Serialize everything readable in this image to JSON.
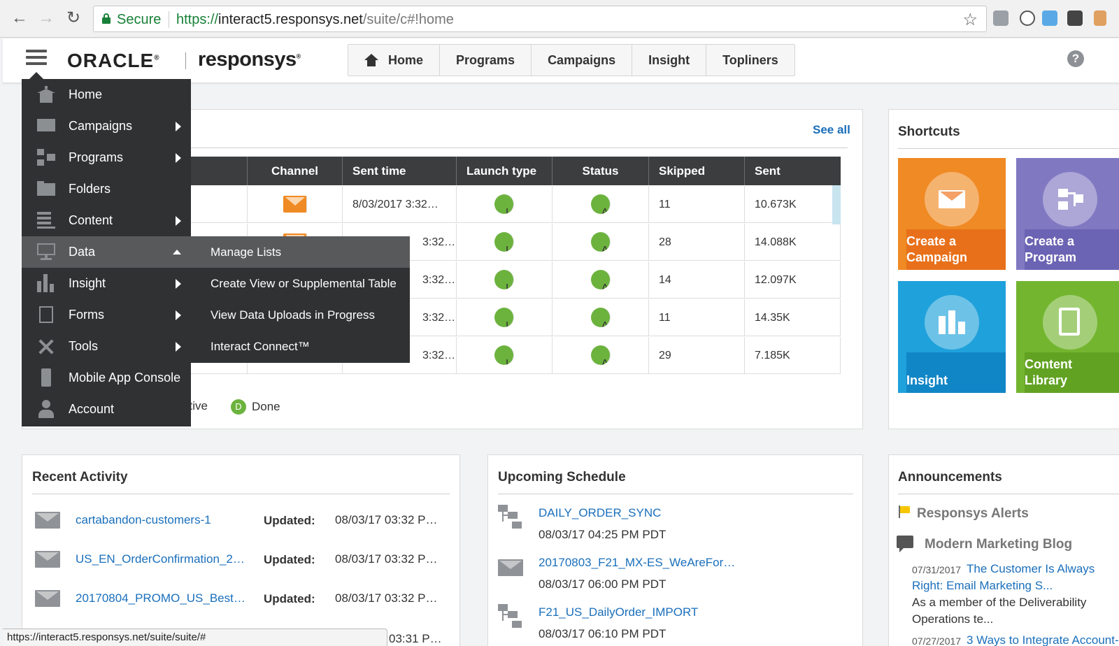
{
  "browser": {
    "secure_label": "Secure",
    "url_scheme": "https://",
    "url_host": "interact5.responsys.net",
    "url_path": "/suite/c#!home",
    "back": "←",
    "forward": "→",
    "reload": "↻",
    "star": "☆"
  },
  "header": {
    "logo_oracle": "ORACLE",
    "logo_reg": "®",
    "logo_responsys": "responsys",
    "logo_tm": "®",
    "help": "?",
    "nav_tabs": [
      {
        "label": "Home"
      },
      {
        "label": "Programs"
      },
      {
        "label": "Campaigns"
      },
      {
        "label": "Insight"
      },
      {
        "label": "Topliners"
      }
    ]
  },
  "side_menu": {
    "items": [
      {
        "label": "Home",
        "icon": "home-icon"
      },
      {
        "label": "Campaigns",
        "icon": "envelope-icon"
      },
      {
        "label": "Programs",
        "icon": "program-icon"
      },
      {
        "label": "Folders",
        "icon": "folder-icon"
      },
      {
        "label": "Content",
        "icon": "content-icon"
      },
      {
        "label": "Data",
        "icon": "data-icon"
      },
      {
        "label": "Insight",
        "icon": "bar-chart-icon"
      },
      {
        "label": "Forms",
        "icon": "forms-icon"
      },
      {
        "label": "Tools",
        "icon": "tools-icon"
      },
      {
        "label": "Mobile App Console",
        "icon": "mobile-icon"
      },
      {
        "label": "Account",
        "icon": "account-icon"
      }
    ]
  },
  "data_submenu": {
    "items": [
      {
        "label": "Manage Lists"
      },
      {
        "label": "Create View or Supplemental Table"
      },
      {
        "label": "View Data Uploads in Progress"
      },
      {
        "label": "Interact Connect™"
      }
    ]
  },
  "campaigns_table": {
    "see_all": "See all",
    "columns": [
      "Channel",
      "Sent time",
      "Launch type",
      "Status",
      "Skipped",
      "Sent"
    ],
    "rows": [
      {
        "sent_time": "8/03/2017 3:32…",
        "launch": "L",
        "status": "A",
        "skipped": "11",
        "sent": "10.673K"
      },
      {
        "sent_time": "3:32…",
        "launch": "L",
        "status": "A",
        "skipped": "28",
        "sent": "14.088K"
      },
      {
        "sent_time": "3:32…",
        "launch": "L",
        "status": "A",
        "skipped": "14",
        "sent": "12.097K"
      },
      {
        "sent_time": "3:32…",
        "launch": "L",
        "status": "A",
        "skipped": "11",
        "sent": "14.35K"
      },
      {
        "sent_time": "3:32…",
        "launch": "L",
        "status": "A",
        "skipped": "29",
        "sent": "7.185K"
      }
    ],
    "legend": [
      {
        "label": "ctive"
      },
      {
        "badge": "D",
        "label": "Done"
      }
    ]
  },
  "shortcuts": {
    "title": "Shortcuts",
    "tiles": [
      {
        "label_line1": "Create a",
        "label_line2": "Campaign",
        "color": "#f08a24",
        "label_bg": "#e8701a"
      },
      {
        "label_line1": "Create a",
        "label_line2": "Program",
        "color": "#7f78c0",
        "label_bg": "#6b63b3"
      },
      {
        "label_line1": "",
        "label_line2": "Insight",
        "color": "#1fa1db",
        "label_bg": "#1186c6"
      },
      {
        "label_line1": "Content",
        "label_line2": "Library",
        "color": "#74b530",
        "label_bg": "#62a223"
      }
    ]
  },
  "recent_activity": {
    "title": "Recent Activity",
    "items": [
      {
        "name": "cartabandon-customers-1",
        "updated": "Updated:",
        "time": "08/03/17 03:32 P…"
      },
      {
        "name": "US_EN_OrderConfirmation_2…",
        "updated": "Updated:",
        "time": "08/03/17 03:32 P…"
      },
      {
        "name": "20170804_PROMO_US_Best…",
        "updated": "Updated:",
        "time": "08/03/17 03:32 P…"
      }
    ],
    "partial_time": "03:31 P…"
  },
  "upcoming_schedule": {
    "title": "Upcoming Schedule",
    "items": [
      {
        "name": "DAILY_ORDER_SYNC",
        "time": "08/03/17 04:25 PM PDT",
        "icon": "flow-icon"
      },
      {
        "name": "20170803_F21_MX-ES_WeAreFor…",
        "time": "08/03/17 06:00 PM PDT",
        "icon": "envelope-icon"
      },
      {
        "name": "F21_US_DailyOrder_IMPORT",
        "time": "08/03/17 06:10 PM PDT",
        "icon": "flow-icon"
      }
    ]
  },
  "announcements": {
    "title": "Announcements",
    "alerts_heading": "Responsys Alerts",
    "blog_heading": "Modern Marketing Blog",
    "posts": [
      {
        "date": "07/31/2017",
        "title_line1": "The Customer Is Always",
        "title_line2": "Right: Email Marketing S...",
        "excerpt_line1": "As a member of the Deliverability",
        "excerpt_line2": "Operations te..."
      },
      {
        "date": "07/27/2017",
        "title_line1": "3 Ways to Integrate Account-"
      }
    ]
  },
  "status_bar": {
    "url": "https://interact5.responsys.net/suite/suite/#"
  },
  "colors": {
    "menu_bg": "#2f3133",
    "menu_active": "#58595b",
    "link": "#1a6fbb",
    "badge_green": "#6cb33e"
  }
}
